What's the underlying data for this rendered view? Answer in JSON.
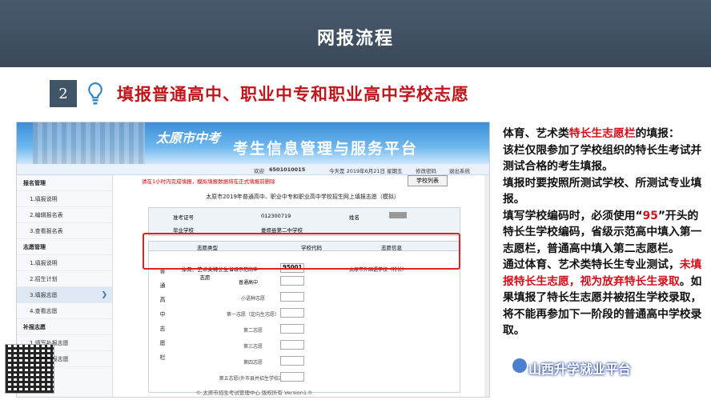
{
  "banner": {
    "title": "网报流程"
  },
  "step": {
    "number": "2",
    "title": "填报普通高中、职业中专和职业高中学校志愿"
  },
  "screenshot": {
    "logo": "太原市中考",
    "header_title": "考生信息管理与服务平台",
    "userbar": {
      "welcome": "欢迎",
      "user_id": "6501010015",
      "date": "今天是 2019年6月21日 星期五",
      "change_pwd": "修改密码",
      "logout": "退出系统"
    },
    "sidebar": [
      {
        "label": "报名管理",
        "group": true
      },
      {
        "label": "1.填报说明",
        "group": false
      },
      {
        "label": "2.编辑报名表",
        "group": false
      },
      {
        "label": "3.查看报名表",
        "group": false
      },
      {
        "label": "志愿管理",
        "group": true
      },
      {
        "label": "1.填报说明",
        "group": false
      },
      {
        "label": "2.招生计划",
        "group": false
      },
      {
        "label": "3.填报志愿",
        "group": false,
        "active": true
      },
      {
        "label": "4.查看志愿",
        "group": false
      },
      {
        "label": "补报志愿",
        "group": true
      },
      {
        "label": "1.填写补报志愿",
        "group": false
      },
      {
        "label": "2.查看补报志愿",
        "group": false
      }
    ],
    "notice": "请在1小时内完成填报，模拟填报数据将在正式填报前删除",
    "school_list_button": "学校列表",
    "form_title": "太原市2019年普通高中、职业中专和职业高中学校招生网上填报志愿（模拟）",
    "info": {
      "exam_id_label": "准考证号",
      "exam_id": "012300719",
      "name_label": "姓名",
      "school_label": "毕业学校",
      "school": "娄烦县第二中学校"
    },
    "table_headers": {
      "type": "志愿类型",
      "code": "学校代码",
      "info": "志愿信息"
    },
    "vertical_label": "普通高中志愿栏",
    "special_type": "体育、艺术类特长生志愿",
    "special_sub1": "省级示范高中",
    "special_sub2": "普通高中",
    "special_code": "95001",
    "special_school": "太原市外国语学校（特长）",
    "rows": [
      "小语种志愿",
      "第一志愿（定向生志愿）",
      "第二志愿",
      "第三志愿",
      "第四志愿",
      "第五志愿(外市县并招生学校志愿)"
    ],
    "footer": "© 太原市招生考试管理中心 版权所有 Version1.0"
  },
  "description": {
    "p1_a": "体育、艺术类",
    "p1_b": "特长生志愿栏",
    "p1_c": "的填报：",
    "p2": "该栏仅限参加了学校组织的特长生考试并测试合格的考生填报。",
    "p3": "填报时要按照所测试学校、所测试专业填报。",
    "p4_a": "填写学校编码时，必须使用“",
    "p4_b": "95",
    "p4_c": "”开头的特长生学校编码，省级示范高中填入第一志愿栏，普通高中填入第二志愿栏。",
    "p5_a": "通过体育、艺术类特长生专业测试，",
    "p5_b": "未填报特长生志愿，视为放弃特长生录取",
    "p5_c": "。如果填报了特长生志愿并被招生学校录取，将不能再参加下一阶段的普通高中学校录取。"
  },
  "brand": "山西升学就业平台",
  "colors": {
    "accent_red": "#d0101a",
    "banner": "#3f4e60"
  }
}
